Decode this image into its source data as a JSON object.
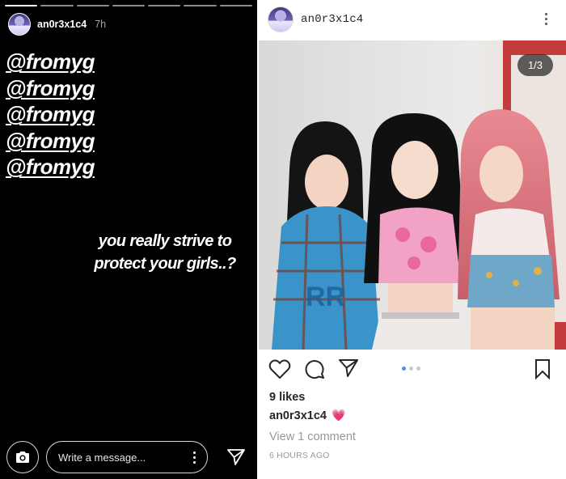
{
  "story": {
    "username": "an0r3x1c4",
    "time": "7h",
    "mentions": [
      "@fromyg",
      "@fromyg",
      "@fromyg",
      "@fromyg",
      "@fromyg"
    ],
    "text": "you really strive to protect your girls..?",
    "message_placeholder": "Write a message...",
    "icons": {
      "camera": "camera-icon",
      "send": "send-icon",
      "more": "more-vertical-icon"
    }
  },
  "post": {
    "username": "an0r3x1c4",
    "counter": "1/3",
    "likes": "9 likes",
    "caption_user": "an0r3x1c4",
    "caption_emoji": "💗",
    "view_comments": "View 1 comment",
    "time_ago": "6 HOURS AGO",
    "carousel_dots": 3,
    "carousel_active": 0,
    "icons": {
      "like": "heart-icon",
      "comment": "comment-icon",
      "share": "send-icon",
      "save": "bookmark-icon",
      "more": "more-vertical-icon"
    },
    "colors": {
      "accent": "#3897f0",
      "text": "#262626",
      "muted": "#999999"
    }
  }
}
